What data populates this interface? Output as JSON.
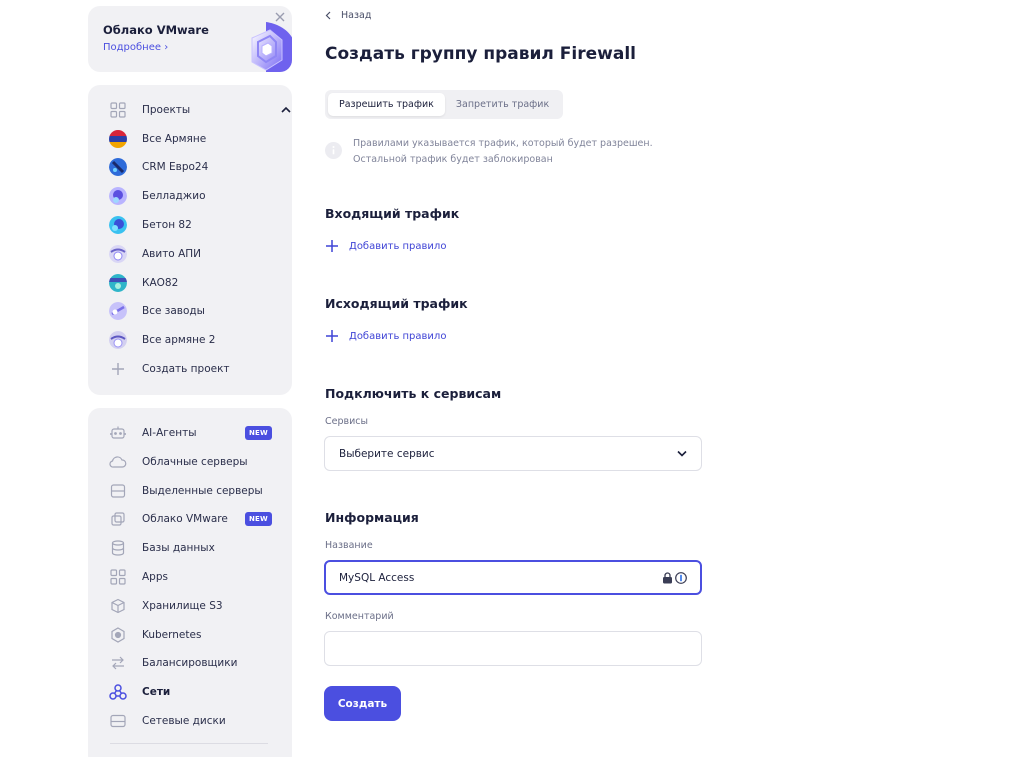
{
  "promo": {
    "title": "Облако VMware",
    "link": "Подробнее ›"
  },
  "projects": {
    "header": "Проекты",
    "items": [
      {
        "label": "Все Армяне"
      },
      {
        "label": "CRM Евро24"
      },
      {
        "label": "Белладжио"
      },
      {
        "label": "Бетон 82"
      },
      {
        "label": "Авито АПИ"
      },
      {
        "label": "КАО82"
      },
      {
        "label": "Все заводы"
      },
      {
        "label": "Все армяне 2"
      }
    ],
    "create": "Создать проект"
  },
  "services": {
    "items": [
      {
        "label": "AI-Агенты",
        "badge": "NEW",
        "icon": "robot-icon"
      },
      {
        "label": "Облачные серверы",
        "icon": "cloud-icon"
      },
      {
        "label": "Выделенные серверы",
        "icon": "server-icon"
      },
      {
        "label": "Облако VMware",
        "badge": "NEW",
        "icon": "vmware-icon"
      },
      {
        "label": "Базы данных",
        "icon": "database-icon"
      },
      {
        "label": "Apps",
        "icon": "apps-icon"
      },
      {
        "label": "Хранилище S3",
        "icon": "cube-icon"
      },
      {
        "label": "Kubernetes",
        "icon": "kubernetes-icon"
      },
      {
        "label": "Балансировщики",
        "icon": "balancer-icon"
      },
      {
        "label": "Сети",
        "icon": "network-icon",
        "active": true
      },
      {
        "label": "Сетевые диски",
        "icon": "disk-icon"
      }
    ]
  },
  "main": {
    "back": "Назад",
    "title": "Создать группу правил Firewall",
    "tabs": [
      "Разрешить трафик",
      "Запретить трафик"
    ],
    "active_tab": 0,
    "info_line1": "Правилами указывается трафик, который будет разрешен.",
    "info_line2": "Остальной трафик будет заблокирован",
    "incoming_title": "Входящий трафик",
    "outgoing_title": "Исходящий трафик",
    "add_rule": "Добавить правило",
    "connect_title": "Подключить к сервисам",
    "services_label": "Сервисы",
    "services_value": "Выберите сервис",
    "info_title": "Информация",
    "name_label": "Название",
    "name_value": "MySQL Access",
    "comment_label": "Комментарий",
    "comment_value": "",
    "create_button": "Создать"
  },
  "colors": {
    "accent": "#4b4fe0",
    "sidebar_bg": "#f1f1f4"
  }
}
